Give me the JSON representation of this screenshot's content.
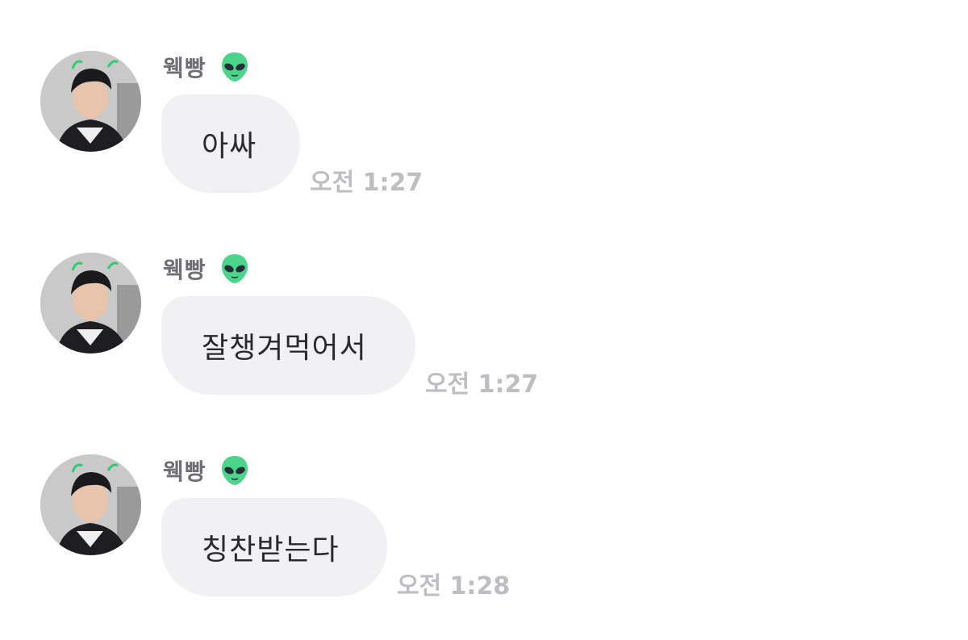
{
  "messages": [
    {
      "sender": "웩빵",
      "icon": "alien-emoji-icon",
      "text": "아싸",
      "time": "오전 1:27"
    },
    {
      "sender": "웩빵",
      "icon": "alien-emoji-icon",
      "text": "잘챙겨먹어서",
      "time": "오전 1:27"
    },
    {
      "sender": "웩빵",
      "icon": "alien-emoji-icon",
      "text": "칭찬받는다",
      "time": "오전 1:28"
    }
  ],
  "colors": {
    "background": "#ffffff",
    "bubble": "#f1f1f4",
    "sender_name": "#6e6e73",
    "timestamp": "#bdbdc2",
    "message_text": "#2a2a2e",
    "alien_green": "#4cd58a"
  }
}
